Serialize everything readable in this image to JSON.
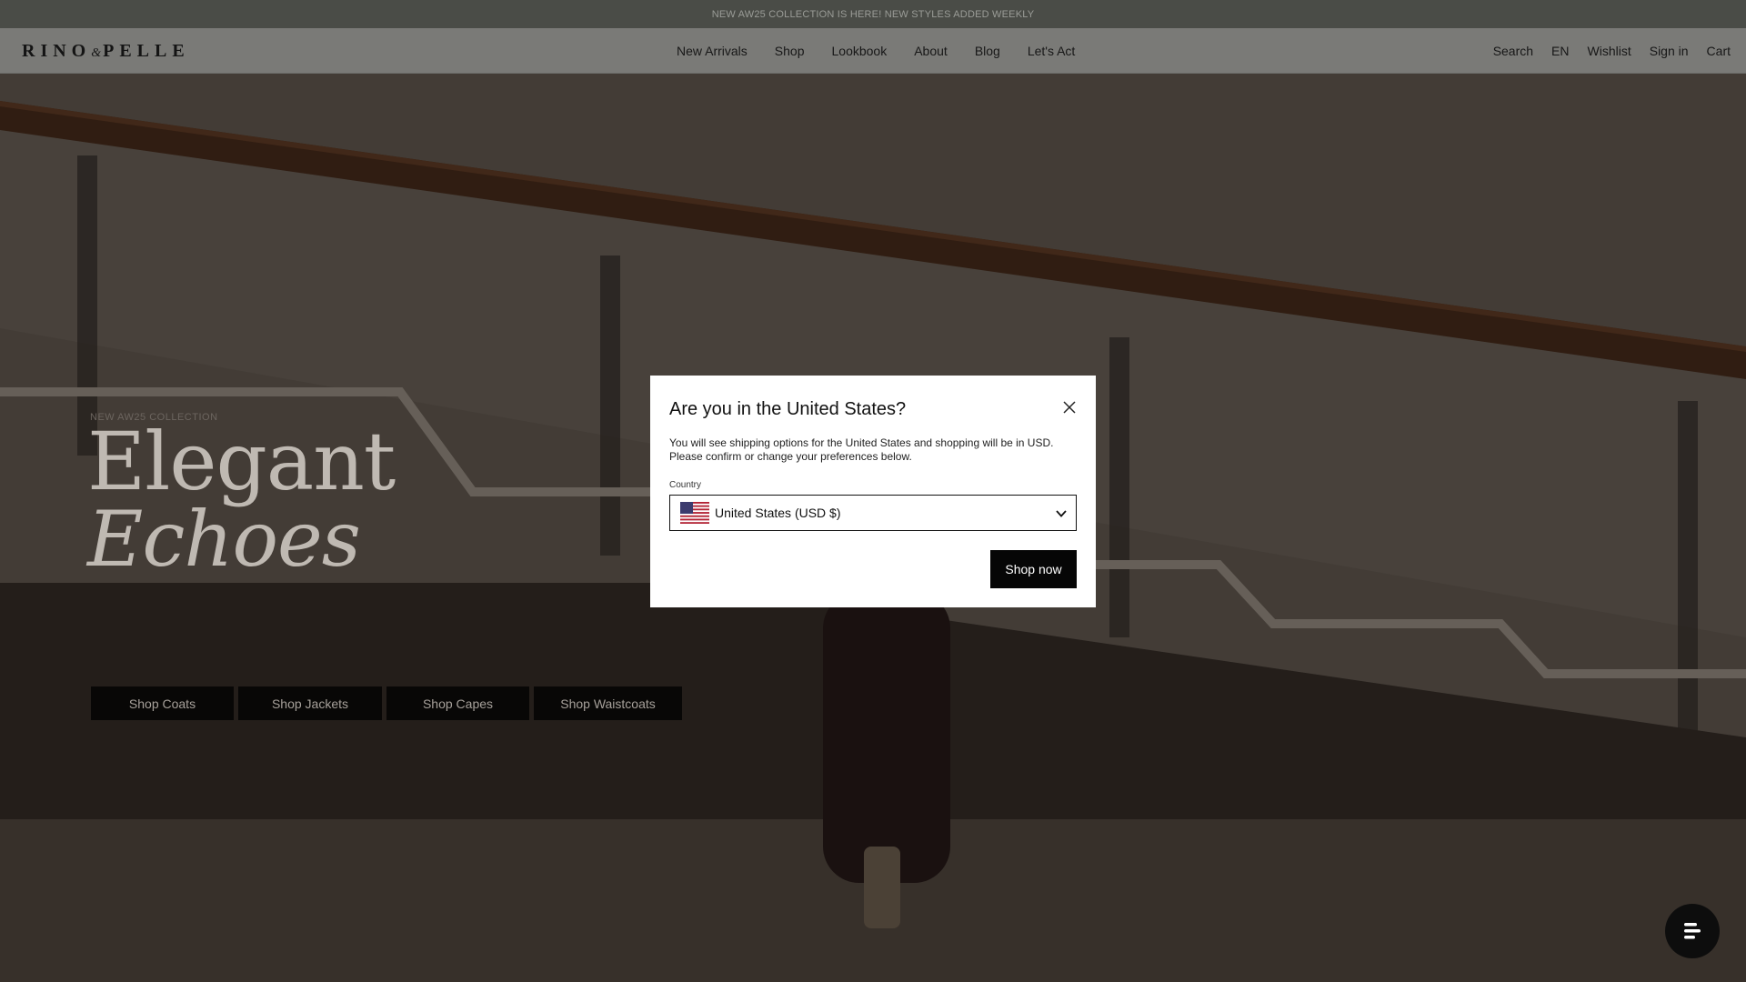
{
  "announcement": "NEW AW25 COLLECTION IS HERE! NEW STYLES ADDED WEEKLY",
  "brand": {
    "part1": "RINO",
    "amp": "&",
    "part2": "PELLE"
  },
  "nav": [
    "New Arrivals",
    "Shop",
    "Lookbook",
    "About",
    "Blog",
    "Let's Act"
  ],
  "utility": {
    "search": "Search",
    "language": "EN",
    "wishlist": "Wishlist",
    "signin": "Sign in",
    "cart": "Cart"
  },
  "hero": {
    "eyebrow": "NEW AW25 COLLECTION",
    "title_line1": "Elegant",
    "title_line2": "Echoes",
    "buttons": [
      "Shop Coats",
      "Shop Jackets",
      "Shop Capes",
      "Shop Waistcoats"
    ]
  },
  "modal": {
    "title": "Are you in the United States?",
    "text": "You will see shipping options for the United States and shopping will be in USD. Please confirm or change your preferences below.",
    "country_label": "Country",
    "country_value": "United States (USD $)",
    "flag_icon": "us-flag-icon",
    "primary_button": "Shop now"
  },
  "chat_icon": "chat-icon",
  "colors": {
    "announce_bg": "#4a4c47",
    "header_bg": "#7a7a77",
    "button_bg": "#060606"
  }
}
